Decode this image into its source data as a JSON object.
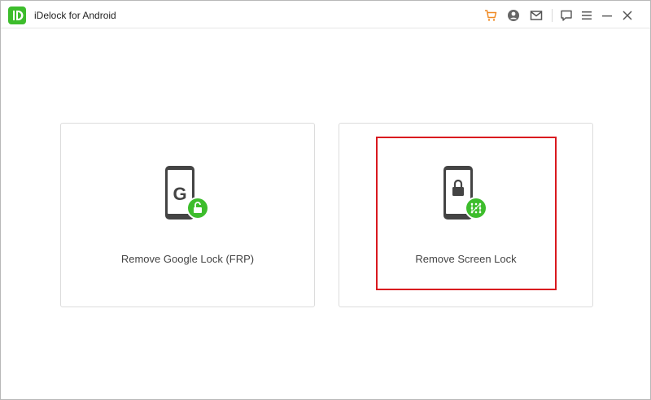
{
  "app": {
    "title": "iDelock for Android",
    "logo_letter": "iD",
    "brand_color": "#3dbd2c"
  },
  "toolbar": {
    "icons": [
      "cart-icon",
      "account-icon",
      "mail-icon",
      "feedback-icon",
      "menu-icon",
      "minimize-icon",
      "close-icon"
    ],
    "cart_color": "#f08a24"
  },
  "cards": [
    {
      "label": "Remove Google Lock (FRP)",
      "icon": "google-lock-phone-icon",
      "badge": "unlock-badge-icon"
    },
    {
      "label": "Remove Screen Lock",
      "icon": "screen-lock-phone-icon",
      "badge": "pattern-badge-icon"
    }
  ],
  "highlight_color": "#d9191f"
}
